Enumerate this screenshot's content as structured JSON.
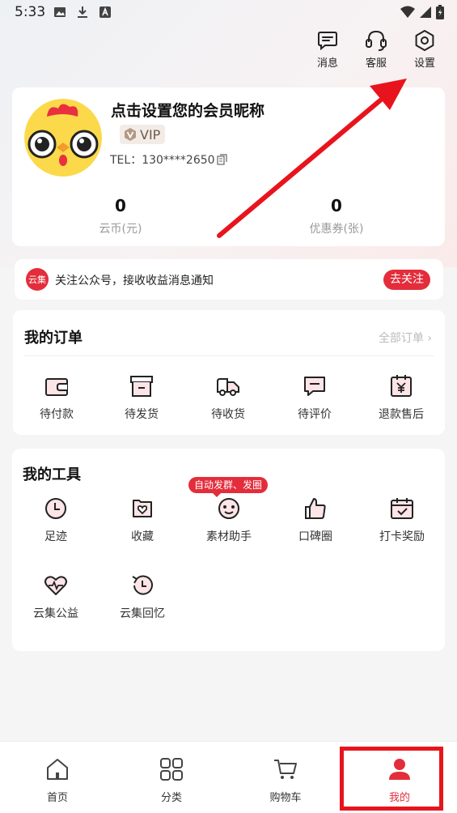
{
  "status_bar": {
    "time": "5:33"
  },
  "top_actions": [
    {
      "label": "消息",
      "icon": "message-icon"
    },
    {
      "label": "客服",
      "icon": "headset-icon"
    },
    {
      "label": "设置",
      "icon": "settings-icon"
    }
  ],
  "profile": {
    "nickname": "点击设置您的会员昵称",
    "vip_label": "VIP",
    "tel": "TEL：130****2650",
    "stats": [
      {
        "value": "0",
        "label": "云币(元)"
      },
      {
        "value": "0",
        "label": "优惠券(张)"
      }
    ]
  },
  "notice": {
    "logo_text": "云集",
    "text": "关注公众号，接收收益消息通知",
    "button": "去关注"
  },
  "orders": {
    "title": "我的订单",
    "all_link": "全部订单 ›",
    "items": [
      {
        "label": "待付款",
        "icon": "wallet-icon"
      },
      {
        "label": "待发货",
        "icon": "box-icon"
      },
      {
        "label": "待收货",
        "icon": "truck-icon"
      },
      {
        "label": "待评价",
        "icon": "comment-icon"
      },
      {
        "label": "退款售后",
        "icon": "refund-icon"
      }
    ]
  },
  "tools": {
    "title": "我的工具",
    "tag": "自动发群、发圈",
    "items": [
      {
        "label": "足迹",
        "icon": "clock-icon"
      },
      {
        "label": "收藏",
        "icon": "favorite-icon"
      },
      {
        "label": "素材助手",
        "icon": "assistant-icon"
      },
      {
        "label": "口碑圈",
        "icon": "thumbs-up-icon"
      },
      {
        "label": "打卡奖励",
        "icon": "calendar-check-icon"
      },
      {
        "label": "云集公益",
        "icon": "heart-pulse-icon"
      },
      {
        "label": "云集回忆",
        "icon": "history-icon"
      }
    ]
  },
  "bottom_nav": [
    {
      "label": "首页",
      "icon": "home-icon"
    },
    {
      "label": "分类",
      "icon": "category-icon"
    },
    {
      "label": "购物车",
      "icon": "cart-icon"
    },
    {
      "label": "我的",
      "icon": "user-icon",
      "active": true
    }
  ],
  "colors": {
    "accent": "#e32d3b",
    "annotation": "#e8141d"
  }
}
